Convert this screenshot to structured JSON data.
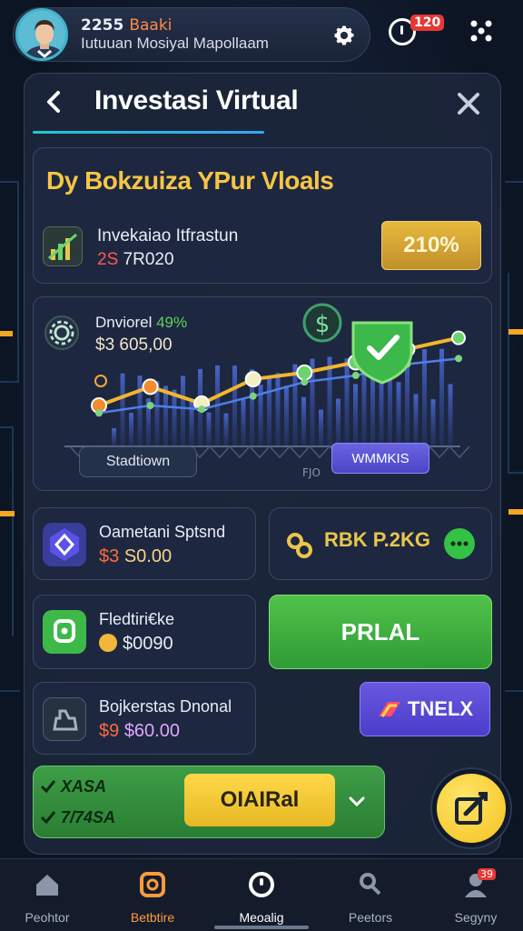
{
  "colors": {
    "accent_yellow": "#f6c544",
    "accent_green": "#4cbf47",
    "accent_purple": "#5a51d9",
    "accent_cyan": "#1fc7d4",
    "background": "#0c1524"
  },
  "header": {
    "coins": "2255",
    "status": "Baaki",
    "subtitle": "Iutuuan Mosiyal Mapollaam",
    "notification_badge": "120"
  },
  "page": {
    "title": "Investasi Virtual"
  },
  "goals": {
    "heading": "Dy Bokzuiza YPur Vloals",
    "item_name": "Invekaiao Itfrastun",
    "item_amount_prefix": "2S",
    "item_amount": "7R020",
    "percent_button": "210%"
  },
  "chart": {
    "label": "Dnviorel",
    "label_pct": "49%",
    "value": "$3 605,00",
    "left_button": "Stadtiown",
    "right_button": "WMMKIS",
    "tiny_note": "FJO"
  },
  "tiles": {
    "t1": {
      "name": "Oametani Sptsnd",
      "value_prefix": "$3",
      "value": "S0.00"
    },
    "t2": {
      "label": "RBK P.2KG"
    },
    "t3": {
      "name": "Fledtiri€ke",
      "value": "$0090"
    },
    "t4": {
      "label": "PRLAL"
    },
    "t5": {
      "name": "Bojkerstas Dnonal",
      "value_prefix": "$9",
      "value": "$60.00"
    },
    "t6": {
      "label": "TNELX"
    }
  },
  "bottom_row": {
    "line1": "XASA",
    "line2": "7/74SA",
    "button": "OIAIRal"
  },
  "tabs": [
    {
      "label": "Peohtor"
    },
    {
      "label": "Betbtire"
    },
    {
      "label": "Meoalig"
    },
    {
      "label": "Peetors"
    },
    {
      "label": "Segyny",
      "badge": "39"
    }
  ],
  "chart_data": {
    "type": "line",
    "series": [
      {
        "values": [
          3,
          5,
          3.2,
          5.8,
          6.5,
          7.6,
          9,
          10.2
        ]
      },
      {
        "values": [
          2.2,
          3,
          2.6,
          4,
          5.5,
          6.2,
          7.4,
          8
        ]
      }
    ]
  }
}
